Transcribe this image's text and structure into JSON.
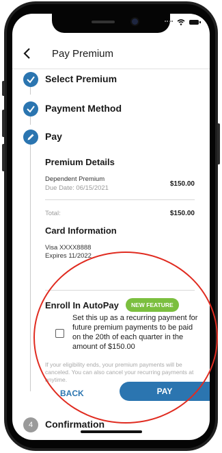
{
  "header": {
    "title": "Pay Premium"
  },
  "steps": [
    {
      "label": "Select Premium",
      "status": "complete"
    },
    {
      "label": "Payment Method",
      "status": "complete"
    },
    {
      "label": "Pay",
      "status": "active"
    },
    {
      "label": "Confirmation",
      "number": "4",
      "status": "pending"
    }
  ],
  "premium_details": {
    "title": "Premium Details",
    "item_name": "Dependent Premium",
    "due_date": "Due Date: 06/15/2021",
    "item_amount": "$150.00",
    "total_label": "Total:",
    "total_amount": "$150.00"
  },
  "card_info": {
    "title": "Card Information",
    "card": "Visa XXXX8888",
    "expires": "Expires 11/2022"
  },
  "autopay": {
    "title": "Enroll In AutoPay",
    "badge": "NEW FEATURE",
    "description": "Set this up as a recurring payment for future premium payments to be paid on the 20th of each quarter in the amount of $150.00",
    "disclaimer": "If your eligibility ends, your premium payments will be canceled. You can also cancel your recurring payments at anytime.",
    "checked": false
  },
  "buttons": {
    "back": "BACK",
    "pay": "PAY"
  },
  "colors": {
    "primary": "#2b75b0",
    "badge": "#7bbf3f",
    "annotation": "#e02b20"
  }
}
